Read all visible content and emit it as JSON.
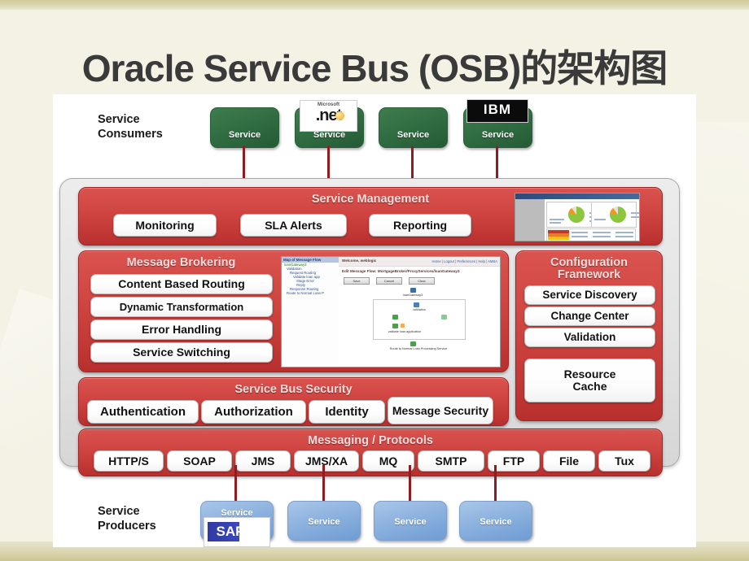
{
  "title": "Oracle Service Bus (OSB)的架构图",
  "consumers": {
    "label_line1": "Service",
    "label_line2": "Consumers",
    "nodes": [
      {
        "caption": "Service",
        "logo": "none"
      },
      {
        "caption": "Service",
        "logo": "dotnet",
        "logo_top": "Microsoft",
        "logo_main": ".net"
      },
      {
        "caption": "Service",
        "logo": "none"
      },
      {
        "caption": "Service",
        "logo": "ibm",
        "logo_main": "IBM"
      }
    ]
  },
  "producers": {
    "label_line1": "Service",
    "label_line2": "Producers",
    "nodes": [
      {
        "caption": "Service",
        "logo": "sap",
        "logo_main": "SAP"
      },
      {
        "caption": "Service",
        "logo": "none"
      },
      {
        "caption": "Service",
        "logo": "none"
      },
      {
        "caption": "Service",
        "logo": "none"
      }
    ]
  },
  "service_management": {
    "title": "Service Management",
    "chips": [
      "Monitoring",
      "SLA Alerts",
      "Reporting"
    ],
    "dashboard": {
      "name": "service-health-dashboard-thumbnail",
      "pie_green_pct": 78,
      "pie_orange_pct": 12
    }
  },
  "message_brokering": {
    "title": "Message Brokering",
    "chips": [
      "Content Based Routing",
      "Dynamic Transformation",
      "Error Handling",
      "Service Switching"
    ],
    "screenshot": {
      "name": "osb-console-message-flow-thumbnail",
      "tree_header": "Map of Message Flow",
      "tree_items": [
        "loanGateway3",
        "Validation",
        "Request Routing",
        "Validate loan app",
        "Stage Error",
        "Reply",
        "Response Routing",
        "Route to Normal Loan P"
      ],
      "welcome": "Welcome, weblogic",
      "links": "Home | Logout | Preferences | Help | AMBA",
      "flow_header": "Edit Message Flow: MortgageBroker/ProxyServices/loanGateway3",
      "buttons": [
        "Save",
        "Cancel",
        "Clear"
      ],
      "node_labels": [
        "loanGateway3",
        "validation",
        "validate loan application",
        "Route to Normal Loan Processing Service"
      ]
    }
  },
  "configuration_framework": {
    "title_line1": "Configuration",
    "title_line2": "Framework",
    "chips": [
      "Service Discovery",
      "Change Center",
      "Validation"
    ],
    "resource_cache_line1": "Resource",
    "resource_cache_line2": "Cache"
  },
  "security": {
    "title": "Service Bus Security",
    "chips": [
      "Authentication",
      "Authorization",
      "Identity",
      "Message Security"
    ]
  },
  "messaging": {
    "title": "Messaging / Protocols",
    "chips": [
      "HTTP/S",
      "SOAP",
      "JMS",
      "JMS/XA",
      "MQ",
      "SMTP",
      "FTP",
      "File",
      "Tux"
    ]
  },
  "colors": {
    "panel_red": "#cf4440",
    "panel_red_dark": "#b8302e",
    "consumer_green": "#2f6b40",
    "producer_blue": "#87aedd",
    "bus_gray": "#e3e3e3",
    "connector_red": "#8e1d22",
    "slide_bg": "#f4f2e4",
    "edge_khaki": "#cfc99a",
    "title_text": "#3a3a3a"
  }
}
